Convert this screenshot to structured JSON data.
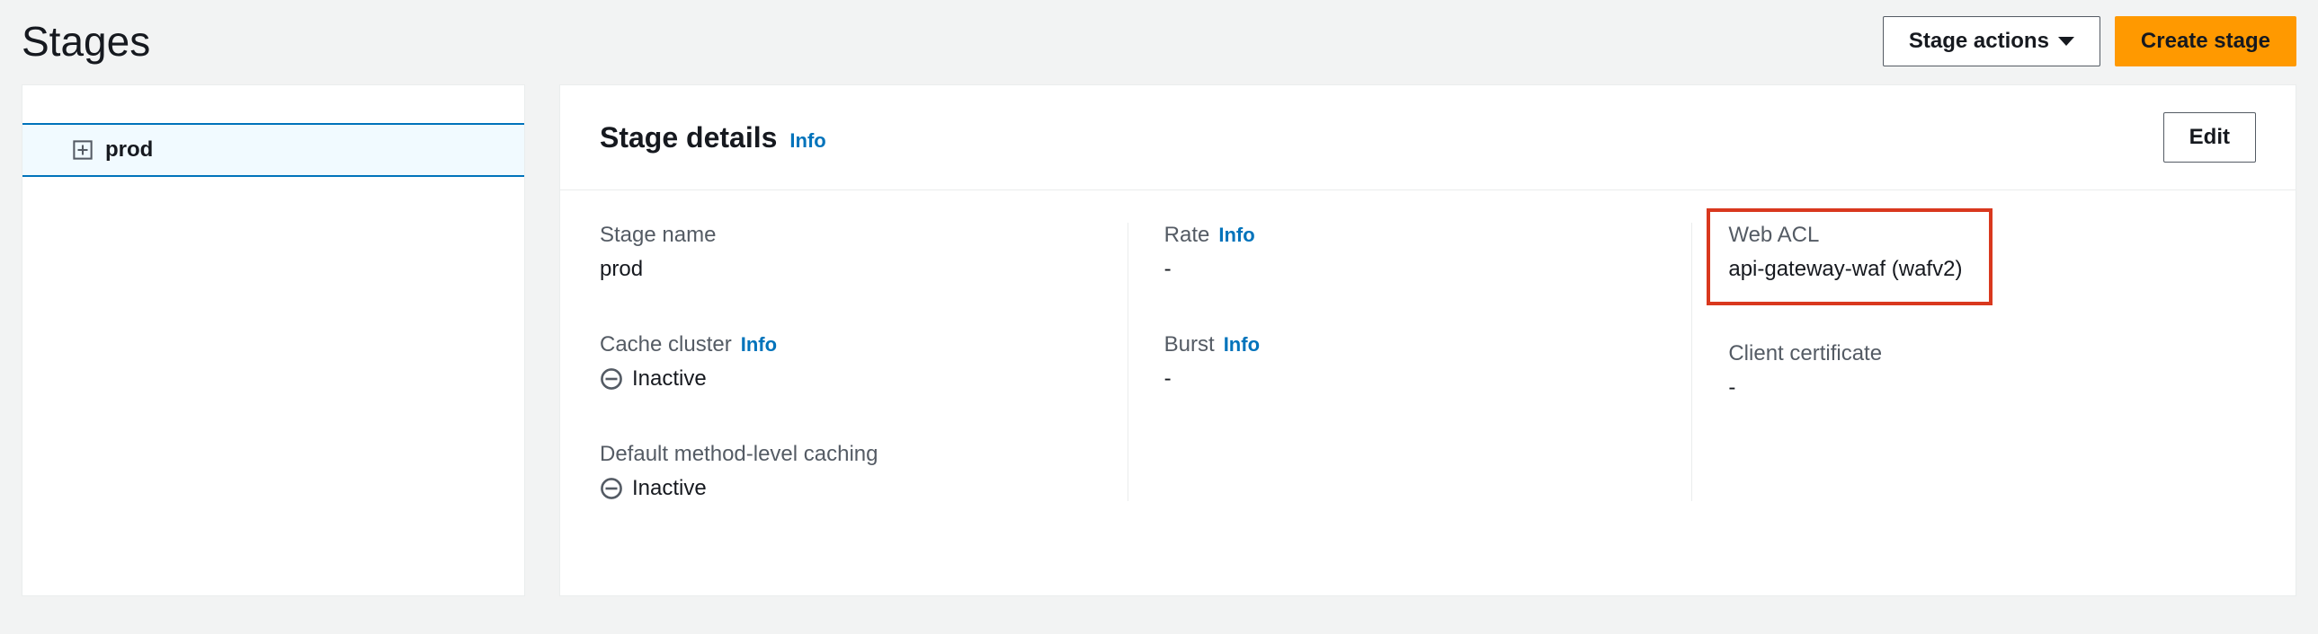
{
  "header": {
    "title": "Stages",
    "stage_actions_label": "Stage actions",
    "create_stage_label": "Create stage"
  },
  "sidebar": {
    "items": [
      {
        "label": "prod"
      }
    ]
  },
  "panel": {
    "title": "Stage details",
    "info_label": "Info",
    "edit_label": "Edit"
  },
  "details": {
    "col1": [
      {
        "label": "Stage name",
        "value": "prod",
        "info": false,
        "icon": null
      },
      {
        "label": "Cache cluster",
        "value": "Inactive",
        "info": true,
        "icon": "inactive"
      },
      {
        "label": "Default method-level caching",
        "value": "Inactive",
        "info": false,
        "icon": "inactive"
      }
    ],
    "col2": [
      {
        "label": "Rate",
        "value": "-",
        "info": true,
        "icon": null
      },
      {
        "label": "Burst",
        "value": "-",
        "info": true,
        "icon": null
      }
    ],
    "col3": [
      {
        "label": "Web ACL",
        "value": "api-gateway-waf (wafv2)",
        "info": false,
        "icon": null,
        "highlight": true
      },
      {
        "label": "Client certificate",
        "value": "-",
        "info": false,
        "icon": null
      }
    ]
  },
  "info_text": "Info"
}
